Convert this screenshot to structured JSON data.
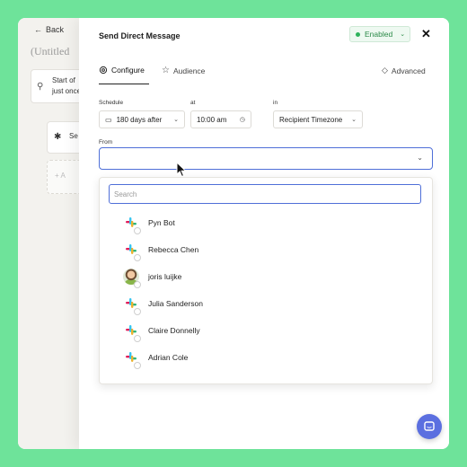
{
  "background": {
    "back_label": "Back",
    "flow_title": "(Untitled",
    "trigger_card": {
      "line1": "Start of",
      "line2": "just once"
    },
    "step_card": {
      "label": "Se"
    },
    "add_card": {
      "label": "+   A"
    }
  },
  "panel": {
    "title": "Send Direct Message",
    "status": {
      "label": "Enabled",
      "color": "#2fb35c"
    },
    "close_label": "✕",
    "tabs": [
      {
        "label": "Configure",
        "icon": "gear-icon",
        "active": true
      },
      {
        "label": "Audience",
        "icon": "star-icon",
        "active": false
      },
      {
        "label": "Advanced",
        "icon": "diamond-icon",
        "active": false
      }
    ],
    "schedule": {
      "label": "Schedule",
      "value": "180 days after",
      "at_label": "at",
      "time": "10:00 am",
      "in_label": "in",
      "timezone": "Recipient Timezone"
    },
    "from": {
      "label": "From",
      "value": "",
      "search_placeholder": "Search",
      "options": [
        {
          "name": "Pyn Bot",
          "avatar": "slack-icon"
        },
        {
          "name": "Rebecca Chen",
          "avatar": "slack-icon"
        },
        {
          "name": "joris luijke",
          "avatar": "user-photo"
        },
        {
          "name": "Julia Sanderson",
          "avatar": "slack-icon"
        },
        {
          "name": "Claire Donnelly",
          "avatar": "slack-icon"
        },
        {
          "name": "Adrian Cole",
          "avatar": "slack-icon"
        }
      ]
    }
  },
  "colors": {
    "accent": "#4f6fd8",
    "page_bg": "#6ee39a",
    "chat_button": "#5b6fe0"
  }
}
